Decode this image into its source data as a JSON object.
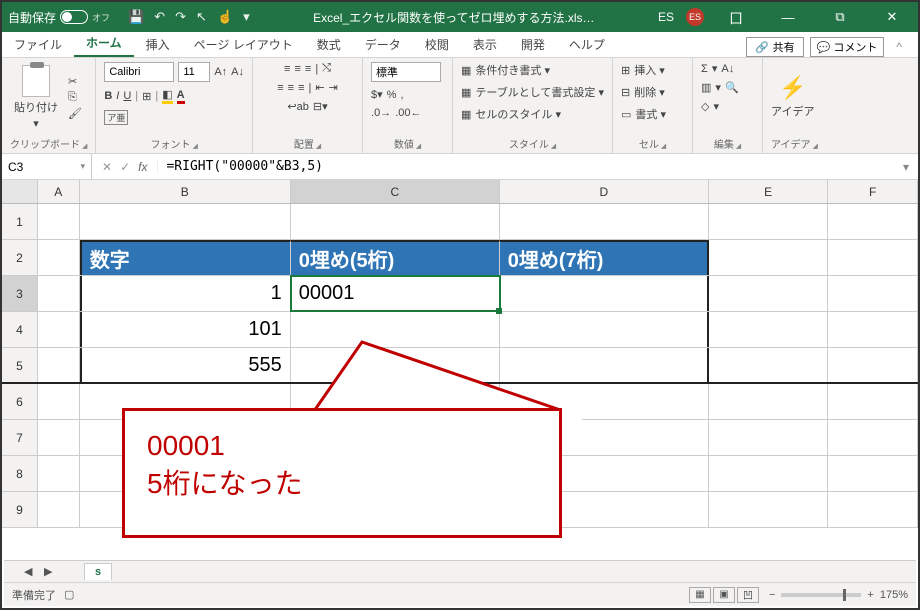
{
  "titlebar": {
    "autosave_label": "自動保存",
    "autosave_state": "オフ",
    "filename": "Excel_エクセル関数を使ってゼロ埋めする方法.xls…",
    "user_initials": "ES",
    "avatar": "ES"
  },
  "tabs": {
    "file": "ファイル",
    "home": "ホーム",
    "insert": "挿入",
    "page_layout": "ページ レイアウト",
    "formulas": "数式",
    "data": "データ",
    "review": "校閲",
    "view": "表示",
    "developer": "開発",
    "help": "ヘルプ",
    "share": "共有",
    "comments": "コメント"
  },
  "ribbon": {
    "clipboard": {
      "paste": "貼り付け",
      "label": "クリップボード"
    },
    "font": {
      "name": "Calibri",
      "size": "11",
      "label": "フォント"
    },
    "alignment": {
      "label": "配置"
    },
    "number": {
      "format": "標準",
      "label": "数値"
    },
    "styles": {
      "cond": "条件付き書式 ▾",
      "table": "テーブルとして書式設定 ▾",
      "cell": "セルのスタイル ▾",
      "label": "スタイル"
    },
    "cells": {
      "insert": "挿入 ▾",
      "delete": "削除 ▾",
      "format": "書式 ▾",
      "label": "セル"
    },
    "editing": {
      "label": "編集"
    },
    "ideas": {
      "btn": "アイデア",
      "label": "アイデア"
    }
  },
  "namebox": "C3",
  "formula": "=RIGHT(\"00000\"&B3,5)",
  "fx": "fx",
  "columns": [
    "A",
    "B",
    "C",
    "D",
    "E",
    "F"
  ],
  "table": {
    "headers": {
      "b": "数字",
      "c": "0埋め(5桁)",
      "d": "0埋め(7桁)"
    },
    "rows": [
      {
        "b": "1",
        "c": "00001",
        "d": ""
      },
      {
        "b": "101",
        "c": "",
        "d": ""
      },
      {
        "b": "555",
        "c": "",
        "d": ""
      }
    ]
  },
  "callout": {
    "line1": "00001",
    "line2": "5桁になった"
  },
  "status": {
    "ready": "準備完了",
    "zoom": "175%",
    "plus": "+",
    "book": "𝄜"
  },
  "sheet": {
    "active": "s"
  },
  "icons": {
    "save": "💾",
    "undo": "↶",
    "redo": "↷",
    "cursor": "↖",
    "touch": "☝",
    "dropdown": "▾",
    "cut": "✂",
    "copy": "⎘",
    "brush": "🖌",
    "bold": "B",
    "italic": "I",
    "underline": "U",
    "border": "⊞",
    "fill": "◧",
    "fontcolor": "A",
    "al_tl": "≡",
    "wrap": "↩",
    "merge": "⊟",
    "currency": "$",
    "percent": "%",
    "comma": ",",
    "inc": "←.0",
    ".dec": ".00→",
    "sigma": "Σ",
    "filldn": "▥",
    "clear": "◇",
    "sortfilter": "⇅",
    "find": "🔍",
    "share": "🔗",
    "comment": "💬",
    "minimize": "—",
    "maximize": "▢",
    "close": "✕",
    "restore": "⧉",
    "ribmin": "^",
    "window": "囗",
    "search": "🔍"
  }
}
